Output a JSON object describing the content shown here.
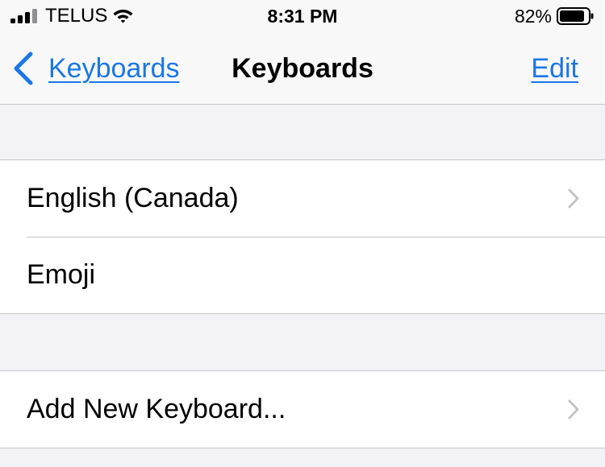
{
  "status_bar": {
    "carrier": "TELUS",
    "time": "8:31 PM",
    "battery_percent": "82%",
    "icons": [
      "cellular-signal-icon",
      "wifi-icon",
      "battery-icon"
    ]
  },
  "nav": {
    "back_label": "Keyboards",
    "title": "Keyboards",
    "edit_label": "Edit",
    "accent_color": "#1a77e6"
  },
  "keyboards": {
    "items": [
      {
        "label": "English (Canada)",
        "has_chevron": true
      },
      {
        "label": "Emoji",
        "has_chevron": false
      }
    ]
  },
  "add_keyboard": {
    "label": "Add New Keyboard..."
  }
}
